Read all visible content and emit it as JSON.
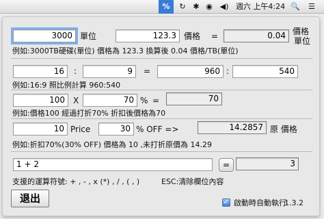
{
  "menubar": {
    "calc_icon": "%",
    "clock_icon": "↻",
    "bluetooth_icon": "✱",
    "wifi_icon": "◉",
    "volume_icon": "◀)",
    "date_time": "週六 上午4:24",
    "search_icon": "🔍",
    "menu_icon": "☰"
  },
  "row1": {
    "storage_value": "3000",
    "storage_unit": "單位",
    "price_value": "123.3",
    "price_label": "價格",
    "equals": "=",
    "result_value": "0.04",
    "result_label_line1": "價格",
    "result_label_line2": "單位",
    "example": "例如:3000TB硬碟(單位) 價格為 123.3 換算後 0.04 價格/TB(單位)"
  },
  "row2": {
    "a_value": "16",
    "colon1": ":",
    "b_value": "9",
    "equals": "=",
    "c_value": "960",
    "colon2": ":",
    "d_value": "540",
    "example": "例如:16:9 照比例計算 960:540"
  },
  "row3": {
    "price_value": "100",
    "times": "X",
    "percent_value": "70",
    "percent_sign": "%",
    "equals": "=",
    "result_value": "70",
    "example": "例如:價格100 經過打折70% 折扣後價格為70"
  },
  "row4": {
    "price_value": "10",
    "price_label": "Price",
    "off_value": "30",
    "off_label": "% OFF =>",
    "result_value": "14.2857",
    "result_label": "原 價格",
    "example": "例如:折扣70%(30% OFF) 價格為 10 ,未打折原價為 14.29"
  },
  "calculator": {
    "expression": "1 + 2",
    "equals_button": "=",
    "result_value": "3",
    "operators_hint": "支援的運算符號: + , - , x (*) , / , ( , )",
    "esc_hint": "ESC:清除欄位內容"
  },
  "footer": {
    "quit_label": "退出",
    "launch_at_login_label": "啟動時自動執行",
    "launch_at_login_checked": true,
    "version": "1.3.2"
  }
}
